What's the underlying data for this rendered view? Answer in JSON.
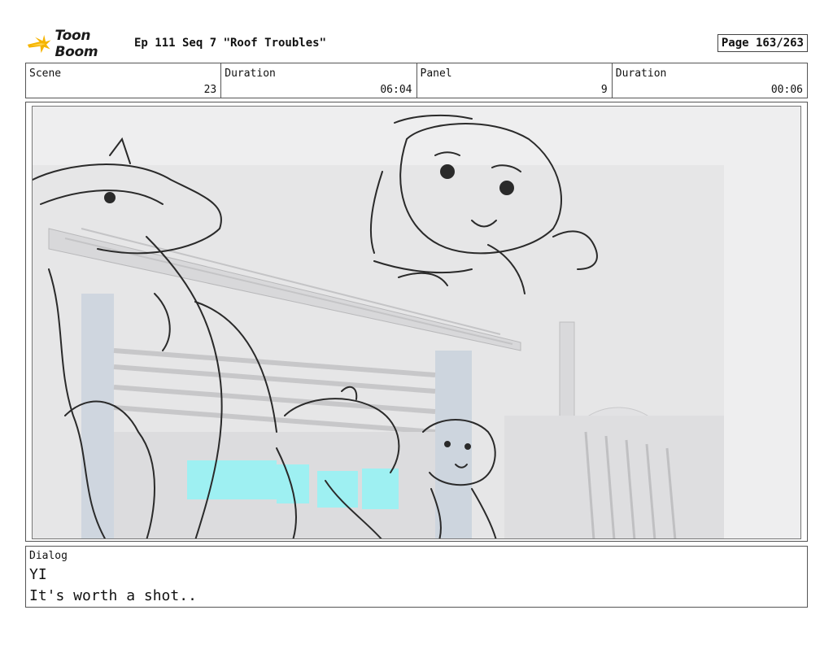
{
  "header": {
    "logo_text": "Toon Boom",
    "title": "Ep 111 Seq 7 \"Roof Troubles\"",
    "page": "Page 163/263"
  },
  "info": {
    "scene_label": "Scene",
    "scene_value": "23",
    "duration_label": "Duration",
    "duration_value": "06:04",
    "panel_label": "Panel",
    "panel_value": "9",
    "panel_duration_label": "Duration",
    "panel_duration_value": "00:06"
  },
  "dialog": {
    "label": "Dialog",
    "lines": [
      "YI",
      "It's worth a shot.."
    ]
  },
  "colors": {
    "logo_accent": "#f5b400",
    "glass": "#9ef0f2"
  }
}
